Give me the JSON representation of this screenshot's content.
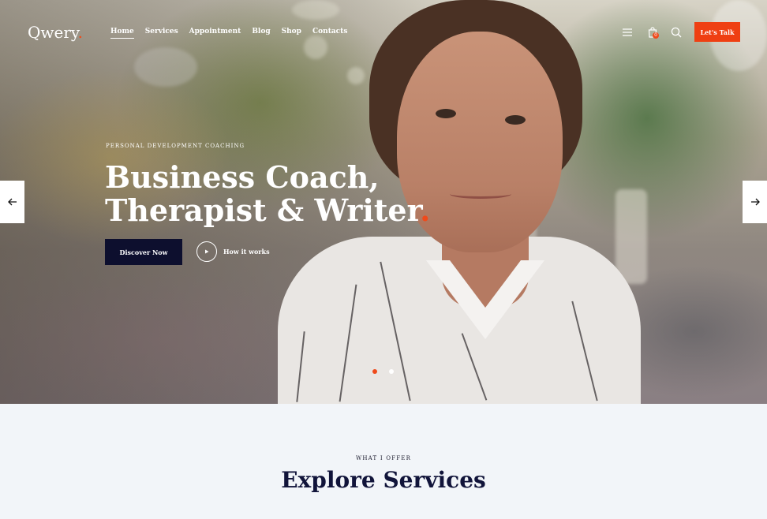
{
  "header": {
    "logo": "Qwery",
    "logo_dot": ".",
    "nav": [
      "Home",
      "Services",
      "Appointment",
      "Blog",
      "Shop",
      "Contacts"
    ],
    "active_nav": "Home",
    "cart_count": "0",
    "cta_label": "Let's Talk"
  },
  "hero": {
    "eyebrow": "PERSONAL DEVELOPMENT COACHING",
    "title_line1": "Business Coach,",
    "title_line2": "Therapist & Writer",
    "title_dot": ".",
    "primary_button": "Discover Now",
    "secondary_button": "How it works",
    "slides": 2,
    "active_slide": 1
  },
  "services": {
    "eyebrow": "WHAT I OFFER",
    "title": "Explore Services"
  },
  "colors": {
    "accent": "#ef4a1b",
    "dark": "#0d0f2e",
    "section_bg": "#f2f5f9"
  },
  "icons": {
    "menu": "hamburger-icon",
    "cart": "shopping-bag-icon",
    "search": "search-icon",
    "prev": "arrow-left-icon",
    "next": "arrow-right-icon",
    "play": "play-icon"
  }
}
